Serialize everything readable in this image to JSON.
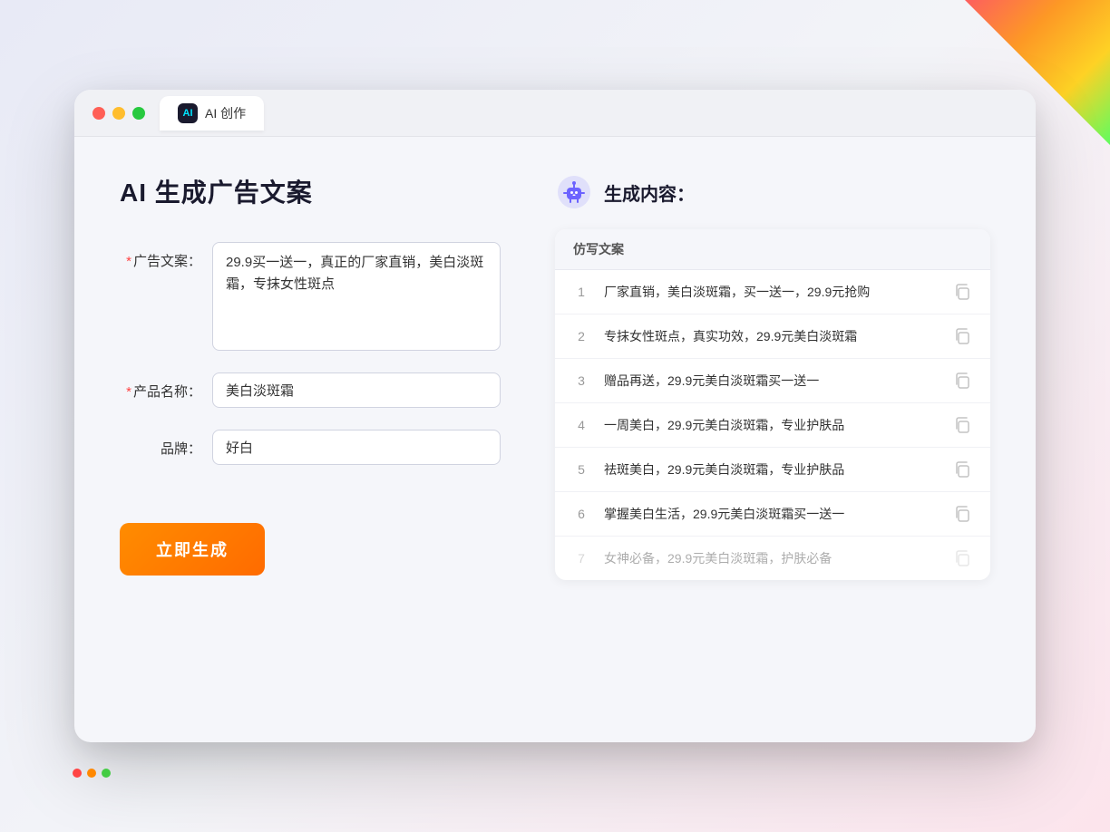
{
  "decorations": {
    "corner_tr": true,
    "corner_bl": true
  },
  "browser": {
    "controls": {
      "close_label": "",
      "minimize_label": "",
      "maximize_label": ""
    },
    "tab": {
      "icon_text": "AI",
      "label": "AI 创作"
    }
  },
  "left_panel": {
    "page_title": "AI 生成广告文案",
    "form": {
      "ad_copy_label": "广告文案：",
      "ad_copy_required": "*",
      "ad_copy_value": "29.9买一送一，真正的厂家直销，美白淡斑霜，专抹女性斑点",
      "product_name_label": "产品名称：",
      "product_name_required": "*",
      "product_name_value": "美白淡斑霜",
      "brand_label": "品牌：",
      "brand_value": "好白"
    },
    "generate_button": "立即生成"
  },
  "right_panel": {
    "robot_title": "生成内容：",
    "table_header": "仿写文案",
    "results": [
      {
        "number": "1",
        "text": "厂家直销，美白淡斑霜，买一送一，29.9元抢购",
        "faded": false
      },
      {
        "number": "2",
        "text": "专抹女性斑点，真实功效，29.9元美白淡斑霜",
        "faded": false
      },
      {
        "number": "3",
        "text": "赠品再送，29.9元美白淡斑霜买一送一",
        "faded": false
      },
      {
        "number": "4",
        "text": "一周美白，29.9元美白淡斑霜，专业护肤品",
        "faded": false
      },
      {
        "number": "5",
        "text": "祛斑美白，29.9元美白淡斑霜，专业护肤品",
        "faded": false
      },
      {
        "number": "6",
        "text": "掌握美白生活，29.9元美白淡斑霜买一送一",
        "faded": false
      },
      {
        "number": "7",
        "text": "女神必备，29.9元美白淡斑霜，护肤必备",
        "faded": true
      }
    ]
  }
}
